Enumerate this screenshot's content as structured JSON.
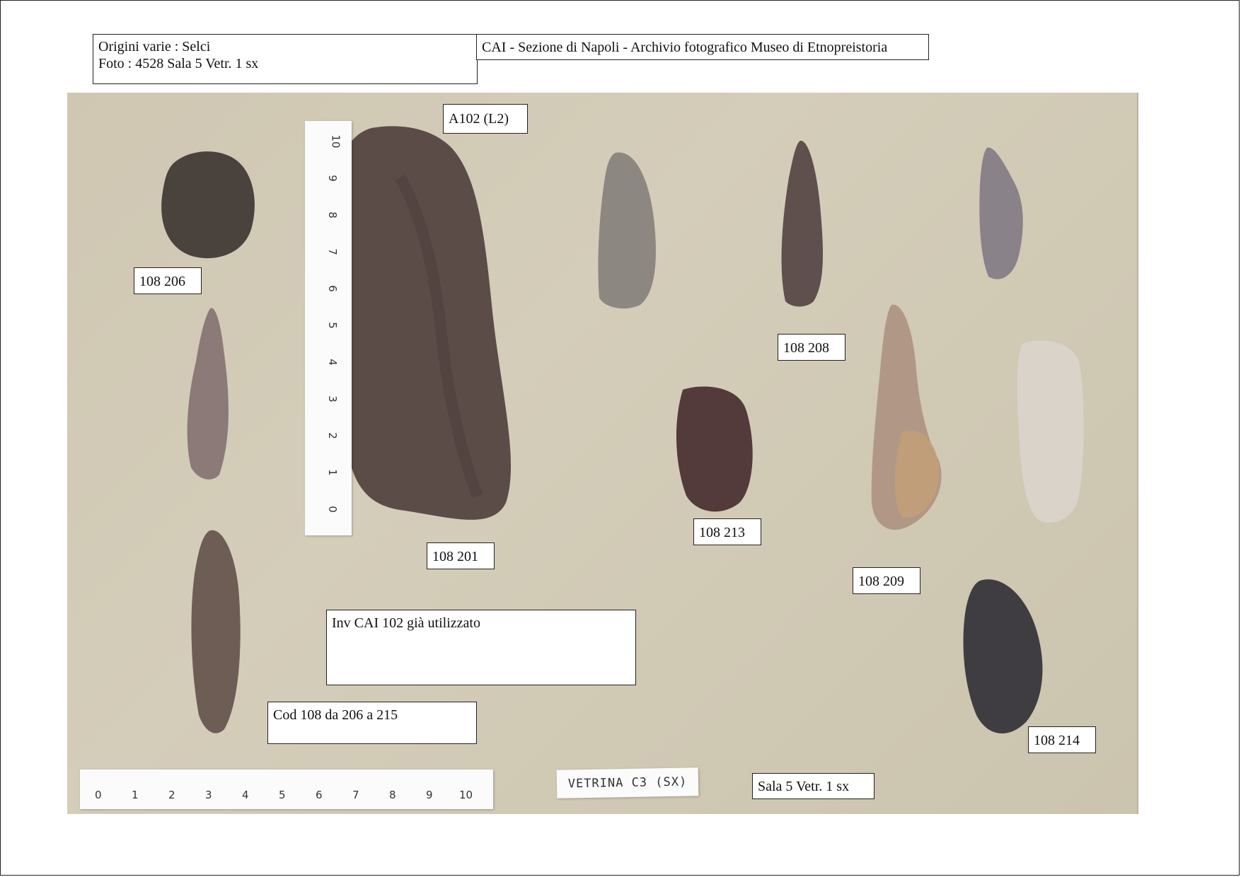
{
  "header": {
    "info_line1": "Origini varie  :  Selci",
    "info_line2": "Foto :  4528    Sala  5    Vetr.  1 sx",
    "archive": "CAI - Sezione di Napoli  - Archivio fotografico Museo di Etnopreistoria"
  },
  "photo": {
    "labels": {
      "a102": "A102  (L2)",
      "n206": "108 206",
      "n201": "108 201",
      "n208": "108 208",
      "n213": "108 213",
      "n209": "108 209",
      "n214": "108 214"
    },
    "note_inv": "Inv CAI 102 già utilizzato",
    "note_cod": "Cod 108 da 206 a 215",
    "note_sala": "Sala 5  Vetr. 1 sx",
    "vetrina_card": "VETRINA C3 (SX)",
    "ruler_numbers": [
      "0",
      "1",
      "2",
      "3",
      "4",
      "5",
      "6",
      "7",
      "8",
      "9",
      "10"
    ]
  }
}
